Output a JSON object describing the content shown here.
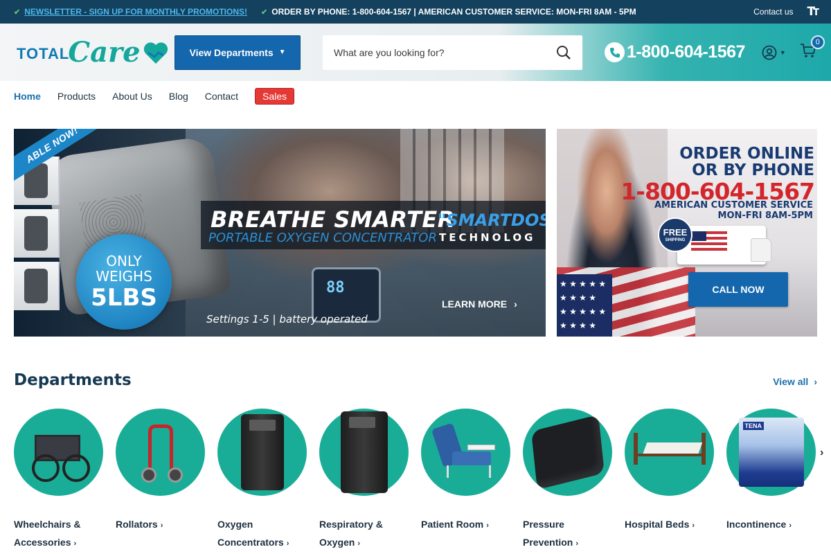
{
  "announcement": {
    "newsletter": "NEWSLETTER - SIGN UP FOR MONTHLY PROMOTIONS!",
    "phone_line": "ORDER BY PHONE: 1-800-604-1567 | AMERICAN CUSTOMER SERVICE: MON-FRI 8AM - 5PM",
    "contact": "Contact us",
    "text_size_icon": "text-size-icon"
  },
  "header": {
    "logo_total": "TOTAL",
    "logo_care": "Care",
    "departments_button": "View Departments",
    "search_placeholder": "What are you looking for?",
    "phone": "1-800-604-1567",
    "cart_count": "0"
  },
  "nav": {
    "items": [
      "Home",
      "Products",
      "About Us",
      "Blog",
      "Contact"
    ],
    "sales": "Sales"
  },
  "hero": {
    "ribbon": "ABLE NOW!",
    "headline": "BREATHE SMARTER",
    "subheadline": "PORTABLE OXYGEN CONCENTRATOR",
    "smartdose": "\"SMARTDOSE",
    "technology": "TECHNOLOG",
    "badge_line1": "ONLY",
    "badge_line2": "WEIGHS",
    "badge_line3": "5LBS",
    "device_display": "88",
    "settings": "Settings 1-5 | battery operated",
    "learn_more": "LEARN MORE"
  },
  "side_banner": {
    "line1": "ORDER ONLINE",
    "line2": "OR BY PHONE",
    "phone": "1-800-604-1567",
    "service1": "AMERICAN CUSTOMER SERVICE",
    "service2": "MON-FRI 8AM-5PM",
    "free": "FREE",
    "shipping": "SHIPPING",
    "call_now": "CALL NOW"
  },
  "departments": {
    "title": "Departments",
    "view_all": "View all",
    "items": [
      {
        "line1": "Wheelchairs &",
        "line2": "Accessories"
      },
      {
        "line1": "Rollators",
        "line2": ""
      },
      {
        "line1": "Oxygen",
        "line2": "Concentrators"
      },
      {
        "line1": "Respiratory &",
        "line2": "Oxygen"
      },
      {
        "line1": "Patient Room",
        "line2": ""
      },
      {
        "line1": "Pressure",
        "line2": "Prevention"
      },
      {
        "line1": "Hospital Beds",
        "line2": ""
      },
      {
        "line1": "Incontinence",
        "line2": ""
      }
    ]
  },
  "colors": {
    "topbar": "#13415e",
    "primary_button": "#1466ad",
    "teal": "#19ad97",
    "sales_badge": "#e53935"
  }
}
